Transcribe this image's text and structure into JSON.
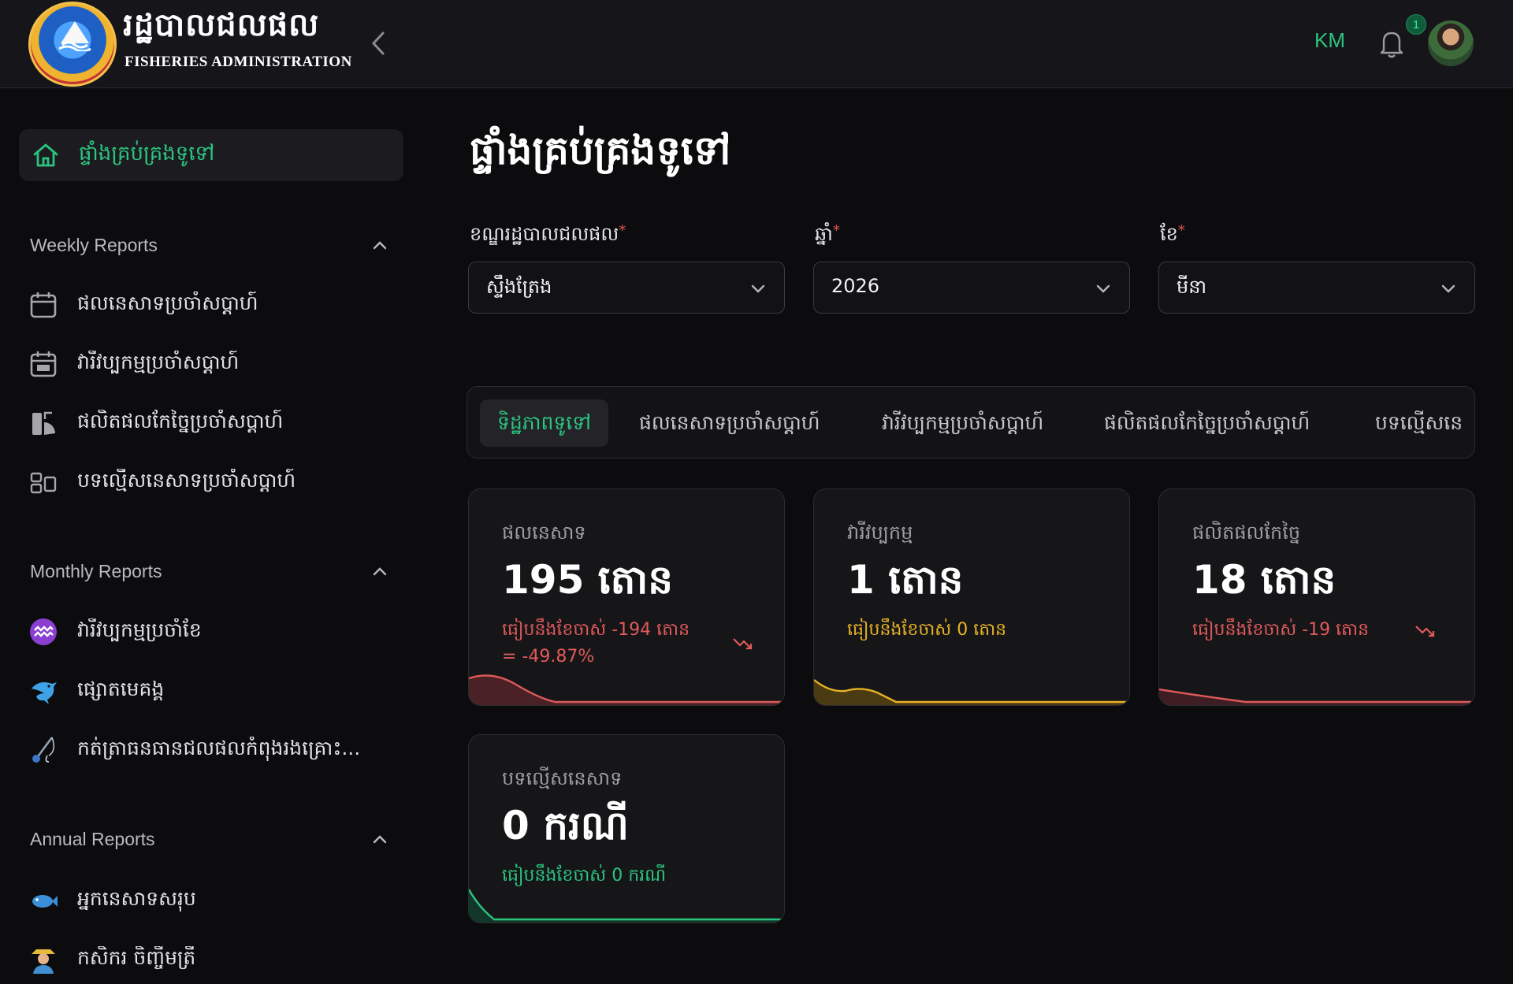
{
  "header": {
    "brand_kh": "រដ្ឋបាលជលផល",
    "brand_en": "FISHERIES ADMINISTRATION",
    "lang": "KM",
    "notification_count": "1",
    "colors": {
      "accent": "#2bc47f",
      "bg": "#16161a"
    }
  },
  "sidebar": {
    "active_item": "ផ្ទាំងគ្រប់គ្រងទូទៅ",
    "sections": [
      {
        "title": "Weekly Reports",
        "items": [
          {
            "label": "ផលនេសាទប្រចាំសប្តាហ៍",
            "icon": "calendar-icon"
          },
          {
            "label": "វារីវប្បកម្មប្រចាំសប្តាហ៍",
            "icon": "calendar-week-icon"
          },
          {
            "label": "ផលិតផលកែច្នៃប្រចាំសប្តាហ៍",
            "icon": "chart-pie-icon"
          },
          {
            "label": "បទល្មើសនេសាទប្រចាំសប្តាហ៍",
            "icon": "report-icon"
          }
        ]
      },
      {
        "title": "Monthly Reports",
        "items": [
          {
            "label": "វារីវប្បកម្មប្រចាំខែ",
            "icon": "aquarius-icon"
          },
          {
            "label": "ផ្សោតមេគង្គ",
            "icon": "dolphin-icon"
          },
          {
            "label": "កត់ត្រាធនធានជលផលកំពុងរងគ្រោះ...",
            "icon": "fishing-icon"
          }
        ]
      },
      {
        "title": "Annual Reports",
        "items": [
          {
            "label": "អ្នកនេសាទសរុប",
            "icon": "fish-icon"
          },
          {
            "label": "កសិករ ចិញ្ចឹមត្រី",
            "icon": "farmer-icon"
          }
        ]
      }
    ]
  },
  "main": {
    "title": "ផ្ទាំងគ្រប់គ្រងទូទៅ",
    "filters": [
      {
        "label": "ខណ្ឌរដ្ឋបាលជលផល",
        "value": "ស្ទឹងត្រែង"
      },
      {
        "label": "ឆ្នាំ",
        "value": "2026"
      },
      {
        "label": "ខែ",
        "value": "មីនា"
      }
    ],
    "tabs": [
      "ទិដ្ឋភាពទូទៅ",
      "ផលនេសាទប្រចាំសប្តាហ៍",
      "វារីវប្បកម្មប្រចាំសប្តាហ៍",
      "ផលិតផលកែច្នៃប្រចាំសប្តាហ៍",
      "បទល្មើសនេ"
    ],
    "cards": [
      {
        "caption": "ផលនេសាទ",
        "value": "195 តោន",
        "comparison": "ធៀបនឹងខែចាស់ -194 តោន",
        "comparison_pct": "= -49.87%",
        "color": "#e05a5a"
      },
      {
        "caption": "វារីវប្បកម្ម",
        "value": "1 តោន",
        "comparison": "ធៀបនឹងខែចាស់ 0 តោន",
        "color": "#e7b226"
      },
      {
        "caption": "ផលិតផលកែច្នៃ",
        "value": "18 តោន",
        "comparison": "ធៀបនឹងខែចាស់ -19 តោន",
        "color": "#e05a5a"
      },
      {
        "caption": "បទល្មើសនេសាទ",
        "value": "0 ករណី",
        "comparison": "ធៀបនឹងខែចាស់ 0 ករណី",
        "color": "#2bc47f"
      }
    ]
  }
}
